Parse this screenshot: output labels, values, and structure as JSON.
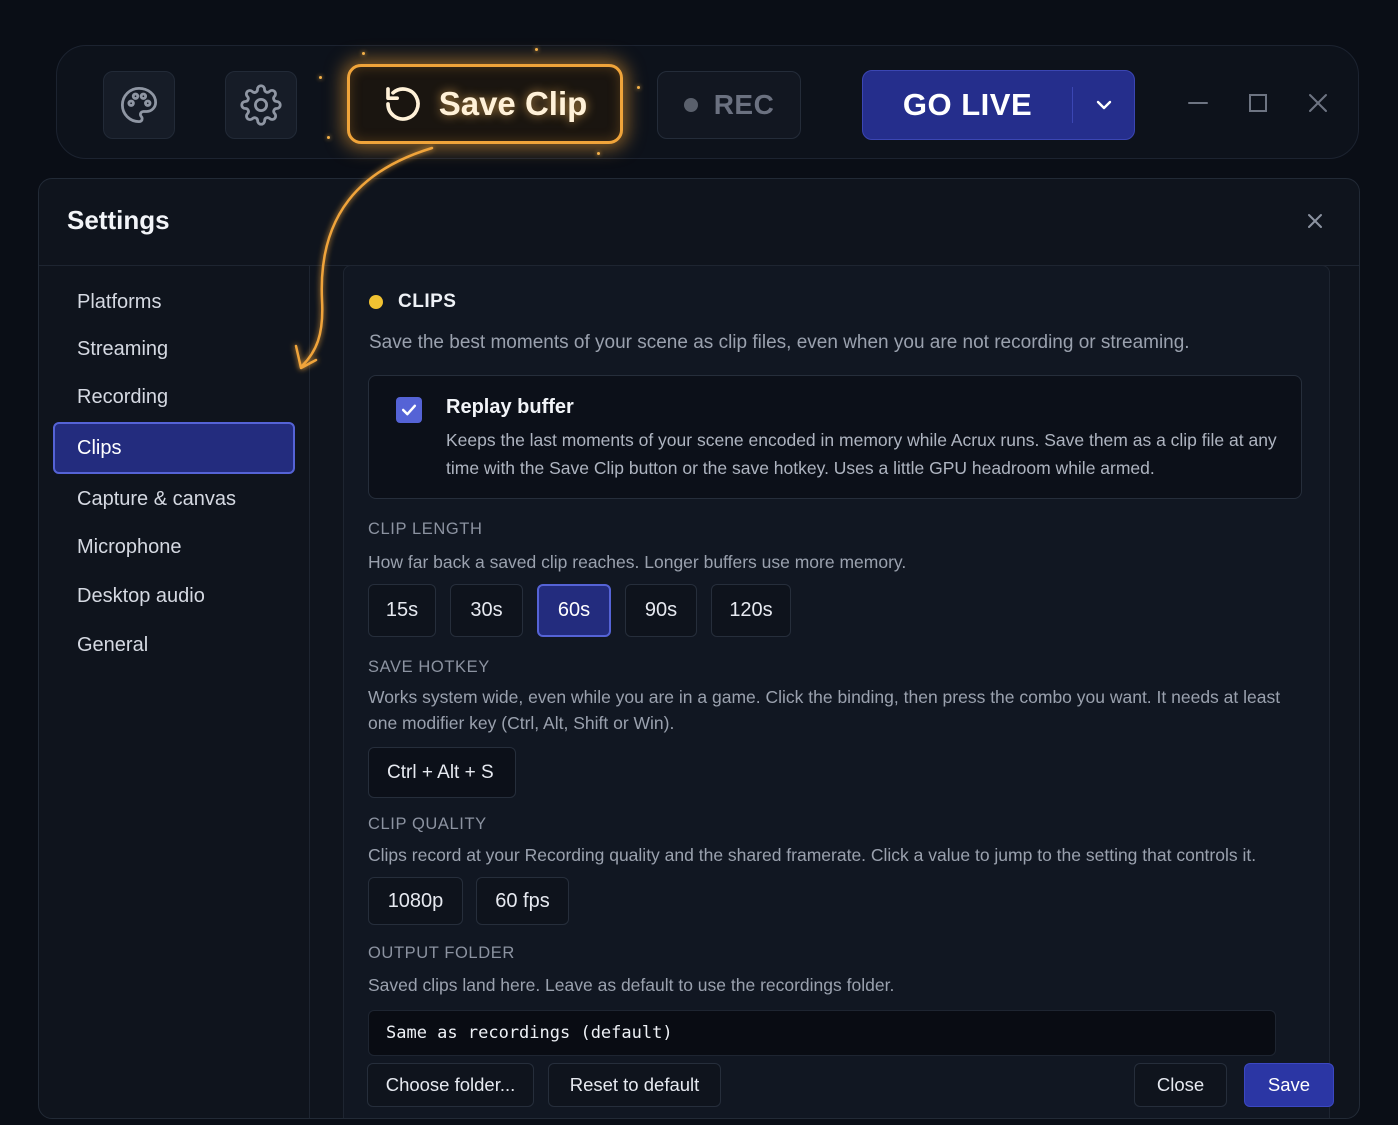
{
  "toolbar": {
    "save_clip_label": "Save Clip",
    "rec_label": "REC",
    "go_live_label": "GO LIVE",
    "accent_color": "#f0a43a",
    "primary_color": "#252e8c"
  },
  "settings": {
    "title": "Settings",
    "nav": [
      {
        "label": "Platforms"
      },
      {
        "label": "Streaming"
      },
      {
        "label": "Recording"
      },
      {
        "label": "Clips",
        "active": true
      },
      {
        "label": "Capture & canvas"
      },
      {
        "label": "Microphone"
      },
      {
        "label": "Desktop audio"
      },
      {
        "label": "General"
      }
    ]
  },
  "clips": {
    "section_title": "CLIPS",
    "section_desc": "Save the best moments of your scene as clip files, even when you are not recording or streaming.",
    "replay": {
      "title": "Replay buffer",
      "checked": true,
      "desc": "Keeps the last moments of your scene encoded in memory while Acrux runs. Save them as a clip file at any time with the Save Clip button or the save hotkey. Uses a little GPU headroom while armed."
    },
    "clip_length": {
      "label": "CLIP LENGTH",
      "desc": "How far back a saved clip reaches. Longer buffers use more memory.",
      "options": [
        "15s",
        "30s",
        "60s",
        "90s",
        "120s"
      ],
      "selected": "60s"
    },
    "save_hotkey": {
      "label": "SAVE HOTKEY",
      "desc": "Works system wide, even while you are in a game. Click the binding, then press the combo you want. It needs at least one modifier key (Ctrl, Alt, Shift or Win).",
      "value": "Ctrl + Alt + S"
    },
    "clip_quality": {
      "label": "CLIP QUALITY",
      "desc": "Clips record at your Recording quality and the shared framerate. Click a value to jump to the setting that controls it.",
      "resolution": "1080p",
      "framerate": "60 fps"
    },
    "output_folder": {
      "label": "OUTPUT FOLDER",
      "desc": "Saved clips land here. Leave as default to use the recordings folder.",
      "value": "Same as recordings (default)",
      "choose_label": "Choose folder...",
      "reset_label": "Reset to default"
    }
  },
  "footer": {
    "close_label": "Close",
    "save_label": "Save"
  }
}
